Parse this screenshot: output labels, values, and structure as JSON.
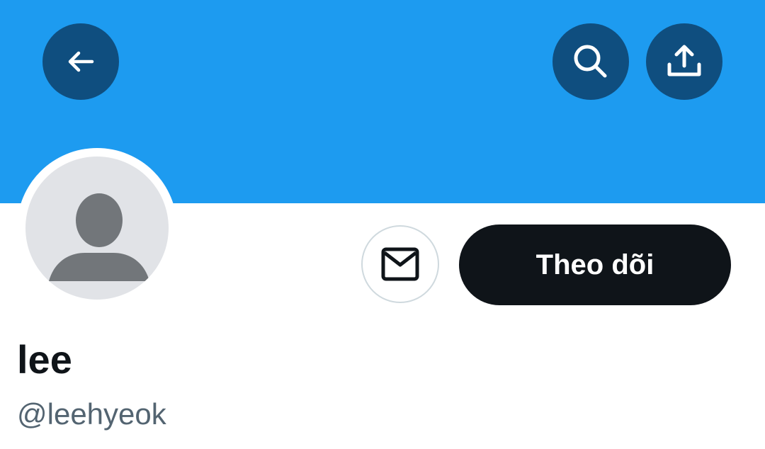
{
  "header": {
    "banner_color": "#1d9bf0",
    "back_icon": "arrow-left-icon",
    "search_icon": "search-icon",
    "share_icon": "share-upload-icon"
  },
  "profile": {
    "avatar_icon": "default-avatar-icon",
    "display_name": "lee",
    "handle": "@leehyeok"
  },
  "actions": {
    "message_icon": "envelope-icon",
    "follow_label": "Theo dõi"
  }
}
